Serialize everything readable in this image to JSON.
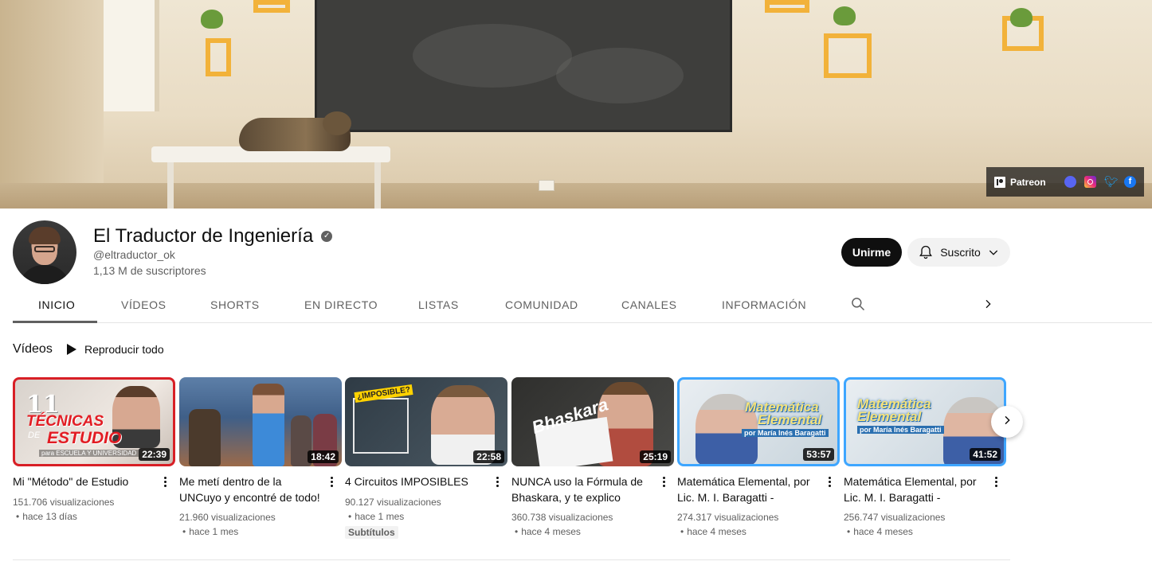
{
  "banner": {
    "social": {
      "patreon_label": "Patreon",
      "icons": [
        "discord-icon",
        "instagram-icon",
        "twitter-icon",
        "facebook-icon"
      ]
    }
  },
  "channel": {
    "name": "El Traductor de Ingeniería",
    "handle": "@eltraductor_ok",
    "subscribers": "1,13 M de suscriptores",
    "join_label": "Unirme",
    "subscribed_label": "Suscrito"
  },
  "tabs": [
    "INICIO",
    "VÍDEOS",
    "SHORTS",
    "EN DIRECTO",
    "LISTAS",
    "COMUNIDAD",
    "CANALES",
    "INFORMACIÓN"
  ],
  "active_tab": "INICIO",
  "section": {
    "title": "Vídeos",
    "play_all": "Reproducir todo"
  },
  "thumbnail_text": {
    "v1_number": "11",
    "v1_line1": "TÉCNICAS",
    "v1_de": "DE",
    "v1_line2": "ESTUDIO",
    "v1_strip": "para ESCUELA Y UNIVERSIDAD",
    "v3_tag": "¿IMPOSIBLE?",
    "v4_word": "Bhaskara",
    "v5_title_1": "Matemática",
    "v5_title_2": "Elemental",
    "v5_sub": "por María Inés Baragatti",
    "v6_title_1": "Matemática",
    "v6_title_2": "Elemental",
    "v6_sub": "por María Inés Baragatti"
  },
  "videos": [
    {
      "title": "Mi \"Método\" de Estudio",
      "duration": "22:39",
      "views": "151.706 visualizaciones",
      "age": "hace 13 días",
      "badge": ""
    },
    {
      "title": "Me metí dentro de la UNCuyo y encontré de todo! - ...",
      "duration": "18:42",
      "views": "21.960 visualizaciones",
      "age": "hace 1 mes",
      "badge": ""
    },
    {
      "title": "4 Circuitos IMPOSIBLES",
      "duration": "22:58",
      "views": "90.127 visualizaciones",
      "age": "hace 1 mes",
      "badge": "Subtítulos"
    },
    {
      "title": "NUNCA uso la Fórmula de Bhaskara, y te explico porqué",
      "duration": "25:19",
      "views": "360.738 visualizaciones",
      "age": "hace 4 meses",
      "badge": ""
    },
    {
      "title": "Matemática Elemental, por Lic. M. I. Baragatti - UNAHU...",
      "duration": "53:57",
      "views": "274.317 visualizaciones",
      "age": "hace 4 meses",
      "badge": ""
    },
    {
      "title": "Matemática Elemental, por Lic. M. I. Baragatti - UNAHU...",
      "duration": "41:52",
      "views": "256.747 visualizaciones",
      "age": "hace 4 meses",
      "badge": ""
    }
  ]
}
